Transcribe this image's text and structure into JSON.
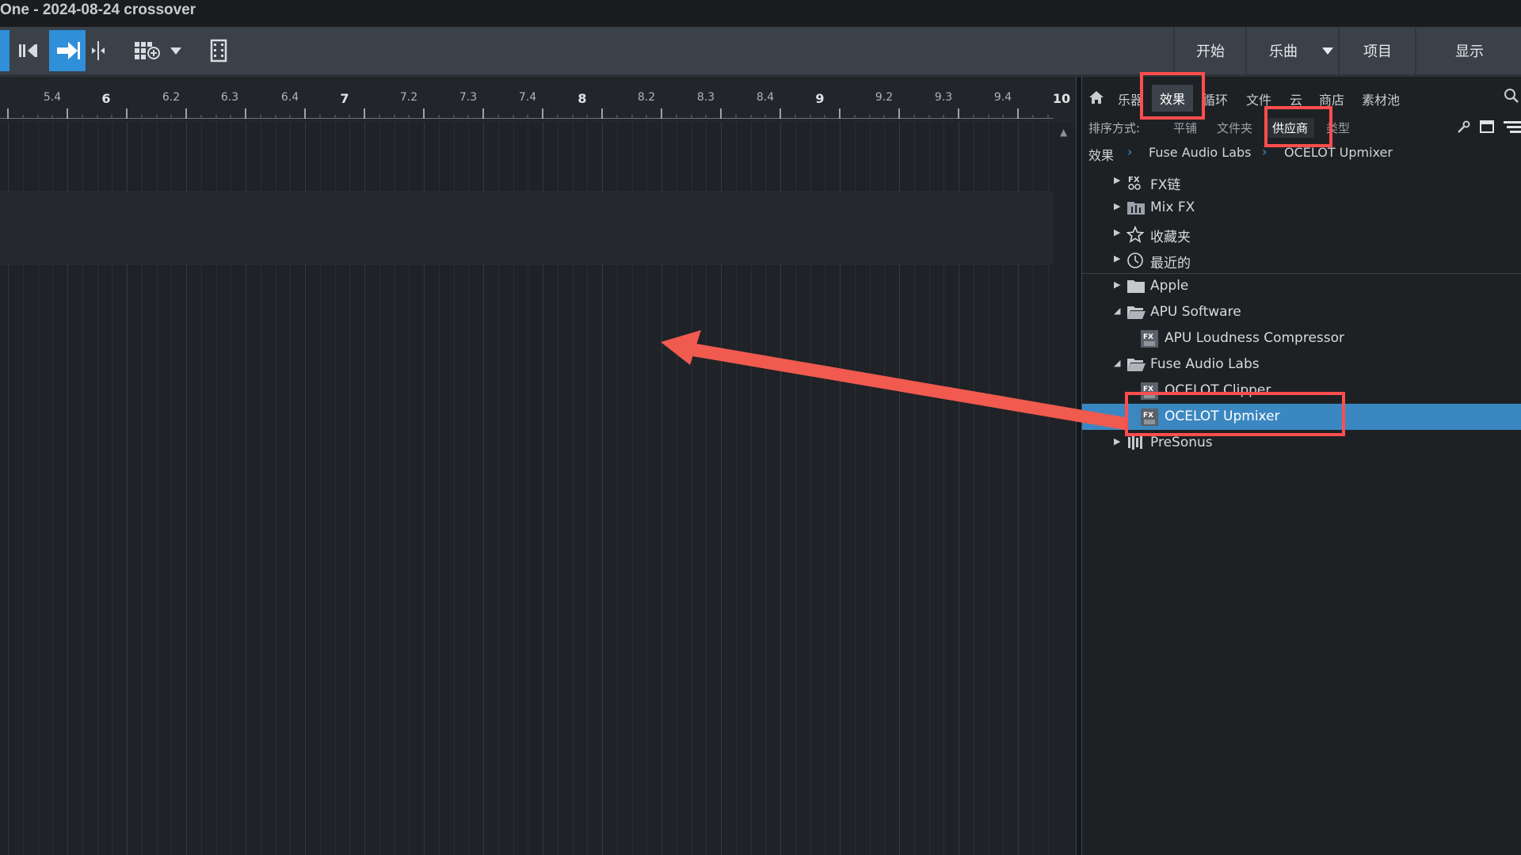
{
  "window": {
    "title": "One - 2024-08-24 crossover"
  },
  "toolbar": {
    "nav": [
      "开始",
      "乐曲",
      "项目",
      "显示"
    ]
  },
  "ruler": {
    "labels": [
      "5.4",
      "6",
      "6.2",
      "6.3",
      "6.4",
      "7",
      "7.2",
      "7.3",
      "7.4",
      "8",
      "8.2",
      "8.3",
      "8.4",
      "9",
      "9.2",
      "9.3",
      "9.4",
      "10"
    ]
  },
  "browser": {
    "tabs": [
      "乐器",
      "效果",
      "循环",
      "文件",
      "云",
      "商店",
      "素材池"
    ],
    "active_tab": "效果",
    "sort": {
      "label": "排序方式:",
      "options": [
        "平铺",
        "文件夹",
        "供应商",
        "类型"
      ],
      "active": "供应商"
    },
    "breadcrumb": [
      "效果",
      "Fuse Audio Labs",
      "OCELOT Upmixer"
    ],
    "tree": [
      {
        "label": "FX链",
        "icon": "fx-chain-icon",
        "expanded": false
      },
      {
        "label": "Mix FX",
        "icon": "mix-fx-icon",
        "expanded": false
      },
      {
        "label": "收藏夹",
        "icon": "star-icon",
        "expanded": false
      },
      {
        "label": "最近的",
        "icon": "clock-icon",
        "expanded": false
      },
      {
        "label": "Apple",
        "icon": "folder-icon",
        "expanded": false
      },
      {
        "label": "APU Software",
        "icon": "folder-open-icon",
        "expanded": true
      },
      {
        "label": "APU Loudness Compressor",
        "icon": "fx-plugin-icon"
      },
      {
        "label": "Fuse Audio Labs",
        "icon": "folder-open-icon",
        "expanded": true
      },
      {
        "label": "OCELOT Clipper",
        "icon": "fx-plugin-icon"
      },
      {
        "label": "OCELOT Upmixer",
        "icon": "fx-plugin-icon",
        "selected": true
      },
      {
        "label": "PreSonus",
        "icon": "presonus-icon",
        "expanded": false
      }
    ]
  },
  "colors": {
    "accent": "#2f8fd8",
    "selection": "#3b87c2",
    "annotation": "#ff4d4d"
  }
}
